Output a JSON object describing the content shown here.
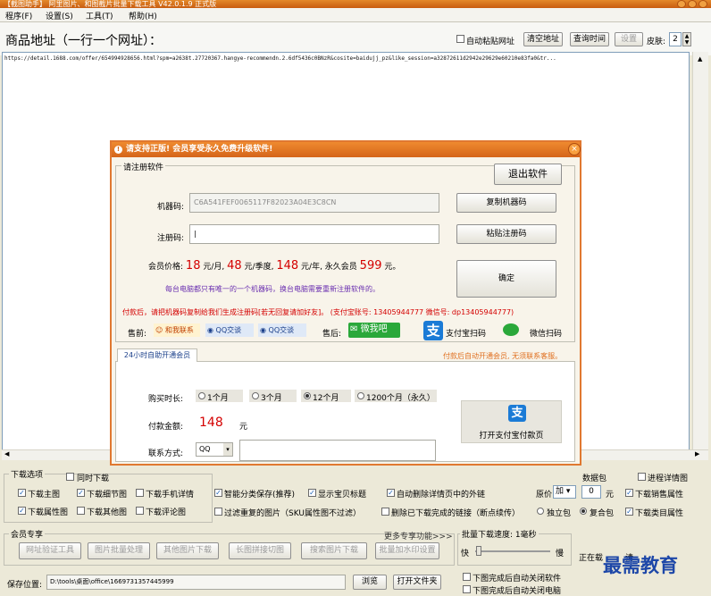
{
  "window": {
    "title": "【截图助手】 阿里图片、和图截片批量下载工具 V42.0.1.9 正式版"
  },
  "menu": [
    "程序(F)",
    "设置(S)",
    "工具(T)",
    "帮助(H)"
  ],
  "urlbar": {
    "header": "商品地址（一行一个网址）：",
    "auto_paste_label": "自动粘贴网址",
    "clear_btn": "清空地址",
    "query_time_btn": "查询时间",
    "settings_btn": "设置",
    "skin_label": "皮肤:",
    "skin_value": "2",
    "url_text": "https://detail.1688.com/offer/654994928656.html?spm=a2638t.27720367.hangye-recommendn.2.6df5436c0BNzR&cosite=baidujj_pz&like_session=a32872611d2942e29629e60210e83fa0&tr..."
  },
  "dialog": {
    "title": "请支持正版! 会员享受永久免费升级软件!",
    "register_group": "请注册软件",
    "exit_btn": "退出软件",
    "machine_code_label": "机器码:",
    "machine_code_value": "C6A541FEF0065117F82023A04E3C8CN",
    "copy_machine_btn": "复制机器码",
    "reg_code_label": "注册码:",
    "paste_reg_btn": "粘贴注册码",
    "price_label": "会员价格:",
    "price_month": "18",
    "price_month_unit": "元/月,",
    "price_quarter": "48",
    "price_quarter_unit": "元/季度,",
    "price_year": "148",
    "price_year_unit": "元/年, 永久会员",
    "price_forever": "599",
    "price_forever_unit": "元。",
    "confirm_btn": "确定",
    "note_machine": "每台电脑都只有唯一的一个机器码，换台电脑需要重新注册软件的。",
    "note_payment": "付款后，请把机器码复制给我们生成注册码[若无回复请加好友]。 (支付宝账号: 13405944777   微信号: dp13405944777)",
    "presale_label": "售前:",
    "aliwang_label": "和我联系",
    "qq1_label": "QQ交谈",
    "qq2_label": "QQ交谈",
    "aftersale_label": "售后:",
    "weiwo_label": "微我吧",
    "alipay_scan": "支付宝扫码",
    "wechat_scan": "微信扫码",
    "tab_self_service": "24小时自助开通会员",
    "auto_open_note": "付款后自动开通会员, 无须联系客服。",
    "duration_label": "购买时长:",
    "duration_options": [
      "1个月",
      "3个月",
      "12个月",
      "1200个月（永久）"
    ],
    "duration_selected": 2,
    "amount_label": "付款金额:",
    "amount_value": "148",
    "amount_unit": "元",
    "contact_label": "联系方式:",
    "contact_type": "QQ",
    "open_alipay_btn": "打开支付宝付款页"
  },
  "options": {
    "download_group": "下载选项",
    "timely_download": "同时下载",
    "items": [
      {
        "label": "下载主图",
        "checked": true
      },
      {
        "label": "下载细节图",
        "checked": true
      },
      {
        "label": "下载手机详情",
        "checked": false
      },
      {
        "label": "下载属性图",
        "checked": true
      },
      {
        "label": "下载其他图",
        "checked": false
      },
      {
        "label": "下载评论图",
        "checked": false
      }
    ],
    "smart_save": "智能分类保存(推荐)",
    "show_title": "显示宝贝标题",
    "auto_remove_links": "自动删除详情页中的外链",
    "filter_dup": "过滤重复的图片（SKU属性图不过滤）",
    "delete_done": "删除已下载完成的链接（断点续传）",
    "price_label": "原价",
    "price_op": "加",
    "price_value": "0",
    "price_unit": "元",
    "data_pack": "数据包",
    "process_detail": "进程详情图",
    "sales_attr": "下载销售属性",
    "standalone_pkg": "独立包",
    "combined_pkg": "复合包",
    "category_attr": "下载类目属性"
  },
  "member": {
    "group": "会员专享",
    "more": "更多专享功能>>>",
    "tools": [
      "网址验证工具",
      "图片批量处理",
      "其他图片下载",
      "长图拼接切图",
      "搜索图片下载",
      "批量加水印设置"
    ]
  },
  "speed": {
    "group": "批量下载速度: 1毫秒",
    "fast": "快",
    "slow": "慢",
    "auto_close_software": "下图完成后自动关闭软件",
    "auto_shutdown": "下图完成后自动关闭电脑"
  },
  "save": {
    "label": "保存位置:",
    "path": "D:\\tools\\桌面\\office\\1669731357445999",
    "browse_btn": "浏览",
    "open_folder_btn": "打开文件夹"
  },
  "status": {
    "downloading": "正在载",
    "please": "请"
  },
  "watermark": "最需教育"
}
